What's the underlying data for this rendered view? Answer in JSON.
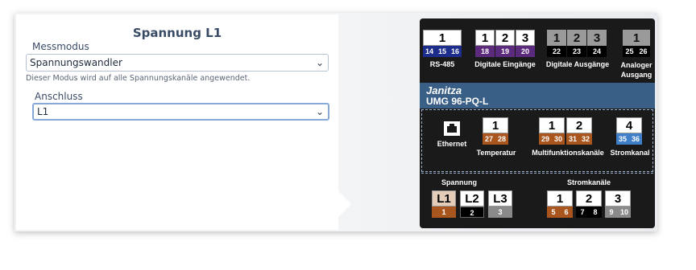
{
  "form": {
    "title": "Spannung L1",
    "mode_label": "Messmodus",
    "mode_value": "Spannungswandler",
    "mode_hint": "Dieser Modus wird auf alle Spannungskanäle angewendet.",
    "conn_label": "Anschluss",
    "conn_value": "L1",
    "chevron": "chevron-down-icon"
  },
  "device": {
    "brand": "Janitza",
    "model": "UMG 96-PQ-L",
    "top": {
      "rs485": {
        "num": "1",
        "pins": [
          "14",
          "15",
          "16"
        ],
        "caption": "RS-485"
      },
      "din": {
        "nums": [
          "1",
          "2",
          "3"
        ],
        "pins": [
          "18",
          "19",
          "20"
        ],
        "caption": "Digitale Eingänge"
      },
      "dout": {
        "nums": [
          "1",
          "2",
          "3"
        ],
        "pins": [
          "22",
          "23",
          "24"
        ],
        "caption": "Digitale Ausgänge"
      },
      "aout": {
        "num": "1",
        "pins": [
          "25",
          "26"
        ],
        "caption": "Analoger Ausgang"
      }
    },
    "mid": {
      "ethernet": "Ethernet",
      "temp": {
        "num": "1",
        "pins": [
          "27",
          "28"
        ],
        "caption": "Temperatur"
      },
      "multi": {
        "nums": [
          "1",
          "2"
        ],
        "pins": [
          "29",
          "30",
          "31",
          "32"
        ],
        "caption": "Multifunktionskanäle"
      },
      "current": {
        "num": "4",
        "pins": [
          "35",
          "36"
        ],
        "caption": "Stromkanal"
      }
    },
    "bottom": {
      "voltage": {
        "caption": "Spannung",
        "labels": [
          "L1",
          "L2",
          "L3"
        ],
        "pins": [
          "1",
          "2",
          "3"
        ]
      },
      "current": {
        "caption": "Stromkanäle",
        "nums": [
          "1",
          "2",
          "3"
        ],
        "pins": [
          "5",
          "6",
          "7",
          "8",
          "9",
          "10"
        ]
      }
    }
  }
}
